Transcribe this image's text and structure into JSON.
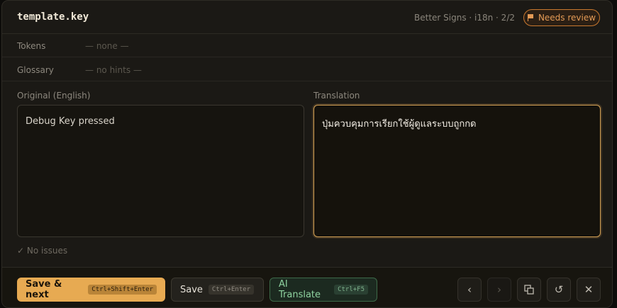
{
  "header": {
    "key": "template.key",
    "breadcrumb": "Better Signs · i18n · 2/2",
    "status_badge": "Needs review"
  },
  "meta": {
    "tokens_label": "Tokens",
    "tokens_value": "— none —",
    "glossary_label": "Glossary",
    "glossary_value": "— no hints —"
  },
  "original": {
    "label": "Original (English)",
    "text": "Debug Key pressed"
  },
  "translation": {
    "label": "Translation",
    "text": "ปุ่มควบคุมการเรียกใช้ผู้ดูแลระบบถูกกด"
  },
  "validation": "✓ No issues",
  "footer": {
    "save_next_label": "Save & next",
    "save_next_shortcut": "Ctrl+Shift+Enter",
    "save_label": "Save",
    "save_shortcut": "Ctrl+Enter",
    "ai_label": "AI Translate",
    "ai_shortcut": "Ctrl+F5",
    "prev_glyph": "‹",
    "next_glyph": "›",
    "reset_glyph": "↺",
    "close_glyph": "✕"
  },
  "colors": {
    "accent": "#e7aa52",
    "review": "#e39a55",
    "ai": "#8fd3a0"
  }
}
